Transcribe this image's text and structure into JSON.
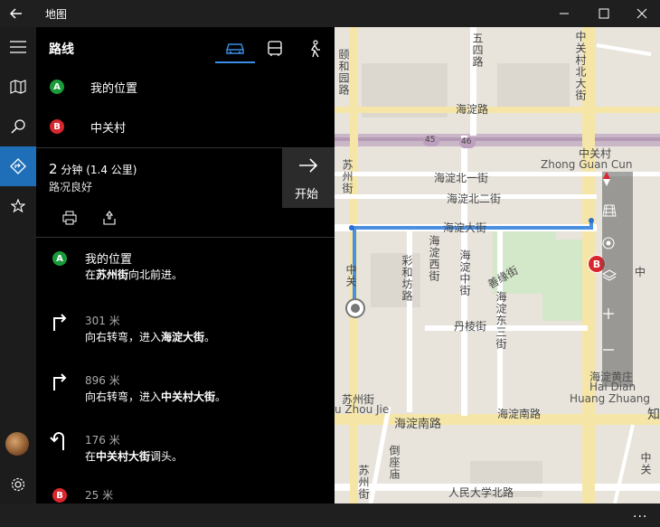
{
  "window": {
    "title": "地图"
  },
  "panel": {
    "title": "路线",
    "start_label": "我的位置",
    "end_label": "中关村",
    "badge_a": "A",
    "badge_b": "B"
  },
  "summary": {
    "time_value": "2",
    "time_unit": "分钟",
    "distance": "(1.4 公里)",
    "traffic": "路况良好",
    "start_button": "开始"
  },
  "steps": [
    {
      "badge": "A",
      "line1": "我的位置",
      "line2_pre": "在",
      "line2_bold": "苏州街",
      "line2_post": "向北前进。"
    },
    {
      "dist": "301 米",
      "line_pre": "向右转弯，进入",
      "line_bold": "海淀大街",
      "line_post": "。"
    },
    {
      "dist": "896 米",
      "line_pre": "向右转弯，进入",
      "line_bold": "中关村大街",
      "line_post": "。"
    },
    {
      "dist": "176 米",
      "line_pre": "在",
      "line_bold": "中关村大街",
      "line_post": "调头。"
    },
    {
      "badge": "B",
      "dist": "25 米"
    }
  ],
  "map": {
    "labels": {
      "wusilu": "五四路",
      "zhongguancun_north": "中关村北大街",
      "yihe": "颐和园路",
      "haidianlu": "海淀路",
      "road45": "45",
      "road46": "46",
      "zgc": "中关村",
      "zgc_en": "Zhong Guan Cun",
      "suzhoujie": "苏州街",
      "haidian_bei_1": "海淀北一街",
      "haidian_bei_2": "海淀北二街",
      "haidian_dajie": "海淀大街",
      "haidian_xijie": "海淀西街",
      "caihefang": "彩和坊路",
      "haidian_zhongjie": "海淀中街",
      "sun_road": "善缘街",
      "danleng": "丹棱街",
      "haidian_dongsanjie": "海淀东三街",
      "zhongguancun_w": "中关",
      "suzhoujie2": "苏州街",
      "suzhoujie_en": "u Zhou Jie",
      "haidian_nanlu": "海淀南路",
      "haidian_nanlu2": "海淀南路",
      "huangzhuang": "海淀黄庄",
      "huangzhuang_en1": "Hai Dian",
      "huangzhuang_en2": "Huang Zhuang",
      "daogou": "倒座庙",
      "suzhoujie3": "苏州街",
      "renmin": "人民大学北路",
      "zhi": "知",
      "zhong": "中",
      "zhong2": "中关"
    },
    "pin_b": "B"
  },
  "icons": {
    "back": "back-arrow-icon",
    "minimize": "minimize-icon",
    "maximize": "maximize-icon",
    "close": "close-icon",
    "menu": "hamburger-icon",
    "map": "map-icon",
    "search": "search-icon",
    "directions": "directions-icon",
    "favorites": "star-icon",
    "settings": "gear-icon",
    "car": "car-icon",
    "bus": "bus-icon",
    "walk": "walk-icon",
    "print": "print-icon",
    "share": "share-icon"
  },
  "colors": {
    "accent": "#1f6fb8",
    "route": "#4a8fe0",
    "badge_a": "#1a9b3a",
    "badge_b": "#d7262e"
  },
  "bottom": {
    "more": "..."
  }
}
